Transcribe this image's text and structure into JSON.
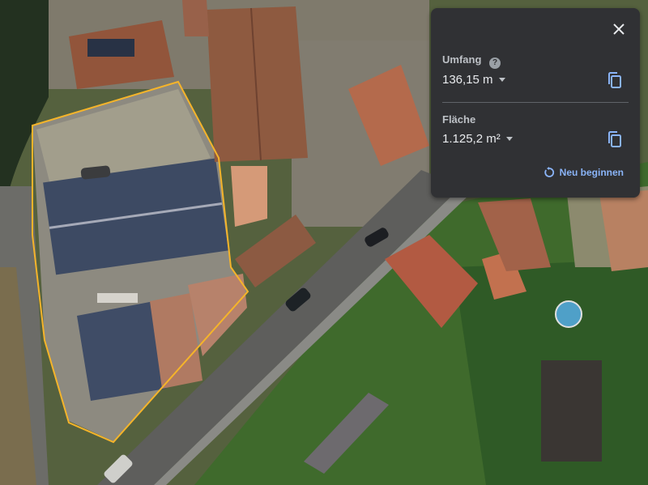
{
  "measure_panel": {
    "perimeter": {
      "label": "Umfang",
      "value": "136,15 m"
    },
    "area": {
      "label": "Fläche",
      "value": "1.125,2 m²"
    },
    "restart_label": "Neu beginnen"
  },
  "icons": {
    "close": "close-icon",
    "help": "help-icon",
    "copy": "copy-icon",
    "restart": "restart-icon",
    "dropdown": "chevron-down-icon"
  },
  "colors": {
    "panel_bg": "#303134",
    "accent": "#8ab4f8",
    "measurement_outline": "#f5b42a"
  }
}
